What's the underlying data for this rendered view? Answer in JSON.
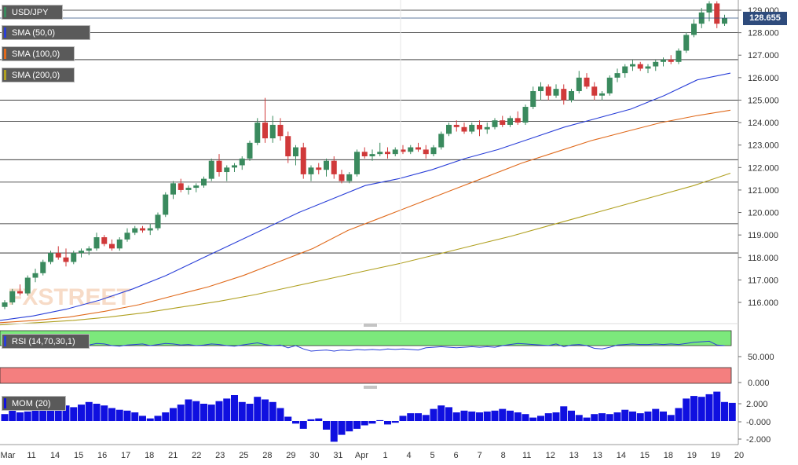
{
  "legend": {
    "symbol": "USD/JPY",
    "sma50": "SMA (50,0)",
    "sma100": "SMA (100,0)",
    "sma200": "SMA (200,0)",
    "rsi": "RSI (14,70,30,1)",
    "mom": "MOM (20)"
  },
  "watermark": "FXSTREET",
  "colors": {
    "up": "#3a8a5e",
    "down": "#d0393a",
    "sma50": "#2a3fd8",
    "sma100": "#e06a1c",
    "sma200": "#b0a020",
    "rsi_band_top": "#7ce87c",
    "rsi_band_bottom": "#f47f7f",
    "mom_bar": "#1010e0",
    "badge": "#2e4b7c"
  },
  "chart_data": [
    {
      "type": "line",
      "title": "USD/JPY",
      "y_ticks": [
        "129.000",
        "128.000",
        "127.000",
        "126.000",
        "125.000",
        "124.000",
        "123.000",
        "122.000",
        "121.000",
        "120.000",
        "119.000",
        "118.000",
        "117.000",
        "116.000"
      ],
      "ylim": [
        115.0,
        129.5
      ],
      "last_price": "128.655",
      "horizontal_levels": [
        129.0,
        128.0,
        126.8,
        125.0,
        124.05,
        122.35,
        121.35,
        119.5,
        118.2
      ],
      "x_labels": [
        "Mar",
        "11",
        "14",
        "15",
        "16",
        "17",
        "18",
        "21",
        "22",
        "23",
        "25",
        "28",
        "29",
        "30",
        "31",
        "Apr",
        "1",
        "4",
        "5",
        "6",
        "7",
        "8",
        "11",
        "12",
        "13",
        "13",
        "14",
        "15",
        "18",
        "19",
        "19",
        "20"
      ],
      "candles": [
        [
          115.8,
          116.1,
          115.7,
          116.0
        ],
        [
          116.0,
          116.6,
          115.9,
          116.5
        ],
        [
          116.5,
          116.8,
          116.3,
          116.4
        ],
        [
          116.4,
          117.2,
          116.3,
          117.1
        ],
        [
          117.1,
          117.5,
          116.9,
          117.3
        ],
        [
          117.3,
          117.9,
          117.2,
          117.8
        ],
        [
          117.8,
          118.3,
          117.7,
          118.2
        ],
        [
          118.2,
          118.5,
          117.9,
          118.0
        ],
        [
          118.0,
          118.4,
          117.6,
          117.8
        ],
        [
          117.8,
          118.3,
          117.7,
          118.2
        ],
        [
          118.2,
          118.4,
          118.0,
          118.3
        ],
        [
          118.3,
          118.5,
          118.1,
          118.4
        ],
        [
          118.4,
          119.1,
          118.3,
          118.9
        ],
        [
          118.9,
          119.0,
          118.5,
          118.6
        ],
        [
          118.6,
          118.8,
          118.3,
          118.4
        ],
        [
          118.4,
          118.9,
          118.3,
          118.8
        ],
        [
          118.8,
          119.3,
          118.7,
          119.1
        ],
        [
          119.1,
          119.4,
          119.0,
          119.3
        ],
        [
          119.3,
          119.4,
          119.1,
          119.2
        ],
        [
          119.2,
          119.5,
          119.0,
          119.3
        ],
        [
          119.3,
          120.0,
          119.2,
          119.9
        ],
        [
          119.9,
          120.9,
          119.8,
          120.8
        ],
        [
          120.8,
          121.4,
          120.6,
          121.3
        ],
        [
          121.3,
          121.5,
          120.9,
          121.0
        ],
        [
          121.0,
          121.2,
          120.8,
          121.1
        ],
        [
          121.1,
          121.3,
          120.9,
          121.2
        ],
        [
          121.2,
          121.6,
          121.1,
          121.5
        ],
        [
          121.5,
          122.4,
          121.4,
          122.3
        ],
        [
          122.3,
          122.6,
          121.6,
          121.8
        ],
        [
          121.8,
          122.1,
          121.4,
          122.0
        ],
        [
          122.0,
          122.2,
          121.8,
          122.1
        ],
        [
          122.1,
          122.5,
          121.9,
          122.4
        ],
        [
          122.4,
          123.2,
          122.3,
          123.1
        ],
        [
          123.1,
          124.2,
          123.0,
          124.0
        ],
        [
          124.0,
          125.1,
          123.1,
          123.3
        ],
        [
          123.3,
          124.3,
          123.1,
          123.9
        ],
        [
          123.9,
          124.2,
          123.2,
          123.4
        ],
        [
          123.4,
          123.6,
          122.2,
          122.5
        ],
        [
          122.5,
          123.0,
          122.1,
          122.9
        ],
        [
          122.9,
          123.1,
          121.5,
          121.7
        ],
        [
          121.7,
          122.1,
          121.4,
          122.0
        ],
        [
          122.0,
          122.2,
          121.7,
          121.9
        ],
        [
          121.9,
          122.4,
          121.6,
          122.3
        ],
        [
          122.3,
          122.5,
          121.5,
          121.7
        ],
        [
          121.7,
          121.9,
          121.3,
          121.4
        ],
        [
          121.4,
          121.8,
          121.3,
          121.7
        ],
        [
          121.7,
          122.8,
          121.6,
          122.7
        ],
        [
          122.7,
          122.9,
          122.4,
          122.5
        ],
        [
          122.5,
          122.8,
          122.3,
          122.6
        ],
        [
          122.6,
          123.1,
          122.5,
          122.7
        ],
        [
          122.7,
          122.9,
          122.4,
          122.6
        ],
        [
          122.6,
          122.9,
          122.5,
          122.8
        ],
        [
          122.8,
          123.0,
          122.6,
          122.7
        ],
        [
          122.7,
          123.0,
          122.6,
          122.9
        ],
        [
          122.9,
          123.1,
          122.7,
          122.8
        ],
        [
          122.8,
          123.0,
          122.4,
          122.6
        ],
        [
          122.6,
          123.0,
          122.5,
          122.9
        ],
        [
          122.9,
          123.6,
          122.8,
          123.5
        ],
        [
          123.5,
          124.0,
          123.4,
          123.9
        ],
        [
          123.9,
          124.1,
          123.6,
          123.8
        ],
        [
          123.8,
          124.0,
          123.5,
          123.6
        ],
        [
          123.6,
          124.0,
          123.5,
          123.9
        ],
        [
          123.9,
          124.1,
          123.4,
          123.7
        ],
        [
          123.7,
          124.0,
          123.5,
          123.8
        ],
        [
          123.8,
          124.2,
          123.7,
          124.1
        ],
        [
          124.1,
          124.3,
          123.8,
          123.9
        ],
        [
          123.9,
          124.3,
          123.8,
          124.2
        ],
        [
          124.2,
          124.5,
          123.9,
          124.0
        ],
        [
          124.0,
          124.8,
          123.9,
          124.7
        ],
        [
          124.7,
          125.6,
          124.6,
          125.4
        ],
        [
          125.4,
          125.8,
          125.0,
          125.6
        ],
        [
          125.6,
          125.7,
          125.0,
          125.2
        ],
        [
          125.2,
          125.7,
          125.1,
          125.5
        ],
        [
          125.5,
          125.7,
          124.8,
          125.0
        ],
        [
          125.0,
          125.5,
          124.9,
          125.4
        ],
        [
          125.4,
          126.3,
          125.3,
          126.0
        ],
        [
          126.0,
          126.2,
          125.5,
          125.6
        ],
        [
          125.6,
          125.8,
          125.0,
          125.2
        ],
        [
          125.2,
          125.4,
          125.0,
          125.3
        ],
        [
          125.3,
          126.1,
          125.2,
          126.0
        ],
        [
          126.0,
          126.4,
          125.8,
          126.2
        ],
        [
          126.2,
          126.6,
          126.0,
          126.5
        ],
        [
          126.5,
          126.8,
          126.3,
          126.6
        ],
        [
          126.6,
          126.7,
          126.3,
          126.4
        ],
        [
          126.4,
          126.6,
          126.2,
          126.5
        ],
        [
          126.5,
          126.8,
          126.3,
          126.7
        ],
        [
          126.7,
          126.9,
          126.5,
          126.8
        ],
        [
          126.8,
          127.0,
          126.6,
          126.7
        ],
        [
          126.7,
          127.3,
          126.6,
          127.2
        ],
        [
          127.2,
          128.0,
          127.1,
          127.9
        ],
        [
          127.9,
          128.6,
          127.8,
          128.4
        ],
        [
          128.4,
          129.1,
          128.2,
          128.9
        ],
        [
          128.9,
          129.4,
          128.5,
          129.3
        ],
        [
          129.3,
          129.4,
          128.2,
          128.4
        ],
        [
          128.4,
          128.8,
          128.3,
          128.655
        ]
      ],
      "sma50": [
        115.2,
        115.4,
        115.7,
        116.1,
        116.6,
        117.2,
        117.9,
        118.6,
        119.3,
        120.0,
        120.6,
        121.2,
        121.5,
        121.9,
        122.4,
        122.8,
        123.3,
        123.8,
        124.2,
        124.6,
        125.2,
        125.9,
        126.2
      ],
      "sma100": [
        115.1,
        115.2,
        115.35,
        115.6,
        115.9,
        116.3,
        116.7,
        117.2,
        117.8,
        118.4,
        119.2,
        119.8,
        120.4,
        121.0,
        121.6,
        122.2,
        122.7,
        123.2,
        123.6,
        124.0,
        124.3,
        124.55
      ],
      "sma200": [
        115.0,
        115.1,
        115.2,
        115.35,
        115.55,
        115.8,
        116.05,
        116.35,
        116.7,
        117.05,
        117.4,
        117.75,
        118.15,
        118.55,
        118.95,
        119.4,
        119.85,
        120.3,
        120.75,
        121.2,
        121.75
      ]
    },
    {
      "type": "line",
      "title": "RSI (14,70,30,1)",
      "y_ticks": [
        "50.000",
        "0.000"
      ],
      "values": [
        72,
        71,
        73,
        70,
        74,
        72,
        69,
        71,
        73,
        70,
        72,
        71,
        74,
        73,
        70,
        69,
        71,
        72,
        73,
        70,
        72,
        74,
        73,
        71,
        72,
        70,
        71,
        73,
        72,
        70,
        69,
        71,
        73,
        75,
        72,
        70,
        71,
        66,
        70,
        64,
        60,
        61,
        62,
        60,
        62,
        61,
        63,
        62,
        63,
        62,
        64,
        63,
        64,
        63,
        62,
        66,
        67,
        68,
        67,
        66,
        67,
        68,
        67,
        68,
        67,
        70,
        72,
        74,
        73,
        72,
        71,
        70,
        73,
        68,
        71,
        72,
        70,
        65,
        64,
        67,
        71,
        72,
        73,
        72,
        72,
        73,
        72,
        73,
        72,
        74,
        76,
        77,
        78,
        71,
        70
      ]
    },
    {
      "type": "bar",
      "title": "MOM (20)",
      "y_ticks": [
        "2.000",
        "-0.000",
        "-2.000"
      ],
      "values": [
        0.8,
        1.2,
        1.0,
        1.1,
        1.4,
        1.6,
        1.9,
        2.0,
        1.8,
        1.6,
        1.9,
        2.2,
        2.0,
        1.8,
        1.5,
        1.3,
        1.2,
        1.0,
        0.6,
        0.3,
        0.6,
        1.0,
        1.5,
        1.9,
        2.5,
        2.3,
        2.0,
        1.9,
        2.3,
        2.6,
        3.0,
        2.2,
        2.0,
        2.8,
        2.5,
        2.2,
        1.5,
        0.5,
        -0.3,
        -0.9,
        0.2,
        0.3,
        -1.0,
        -2.4,
        -1.6,
        -1.2,
        -0.9,
        -0.5,
        -0.3,
        0.1,
        -0.4,
        -0.2,
        0.6,
        0.9,
        0.9,
        0.7,
        1.4,
        1.8,
        1.6,
        1.0,
        1.2,
        1.1,
        1.0,
        1.1,
        1.2,
        1.4,
        1.2,
        1.0,
        0.8,
        0.4,
        0.6,
        0.9,
        1.0,
        1.7,
        1.2,
        0.7,
        0.4,
        0.8,
        0.9,
        0.8,
        1.0,
        1.3,
        1.1,
        0.9,
        1.1,
        1.4,
        1.1,
        0.7,
        1.5,
        2.6,
        2.9,
        2.8,
        3.1,
        3.4,
        2.2,
        2.1
      ]
    }
  ]
}
